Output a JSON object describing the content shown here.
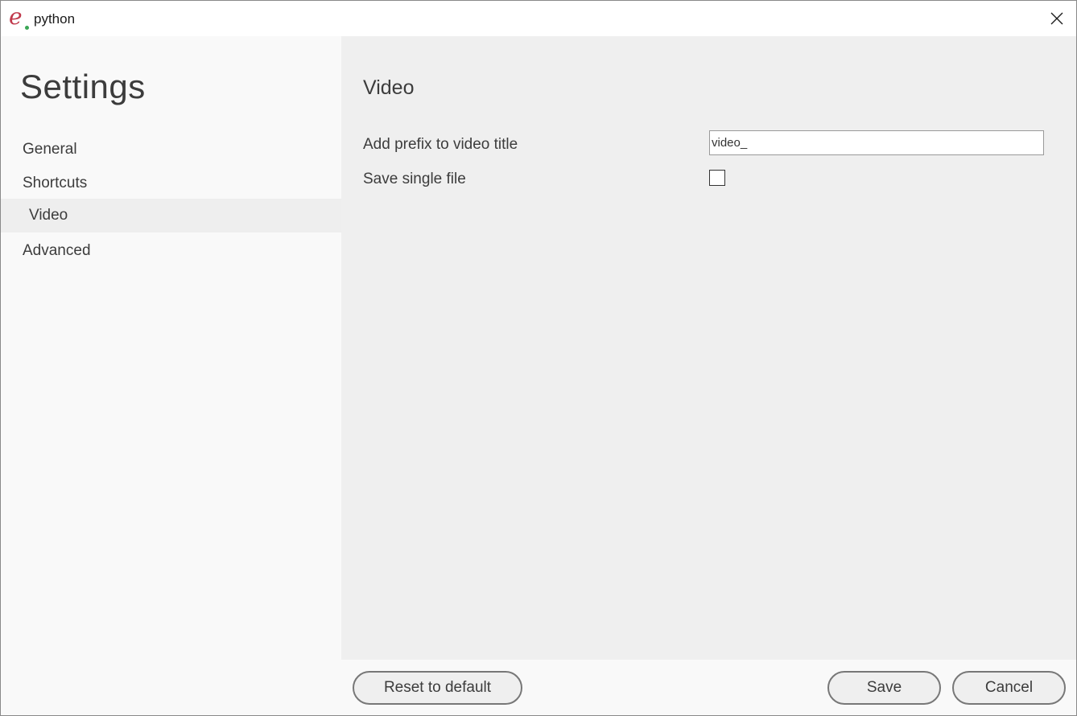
{
  "titlebar": {
    "app_title": "python",
    "logo_letter": "e",
    "close_icon": "close-icon"
  },
  "sidebar": {
    "title": "Settings",
    "items": [
      {
        "label": "General"
      },
      {
        "label": "Shortcuts"
      },
      {
        "label": "Video"
      },
      {
        "label": "Advanced"
      }
    ],
    "active_item": "Video"
  },
  "content": {
    "section_title": "Video",
    "prefix": {
      "label": "Add prefix to video title",
      "value": "video_"
    },
    "single_file": {
      "label": "Save single file",
      "checked": false
    }
  },
  "footer": {
    "reset_label": "Reset to default",
    "save_label": "Save",
    "cancel_label": "Cancel"
  },
  "colors": {
    "logo_e": "#c0394b",
    "logo_dot": "#3aa655",
    "content_bg": "#efefef",
    "sidebar_bg": "#f9f9f9"
  }
}
